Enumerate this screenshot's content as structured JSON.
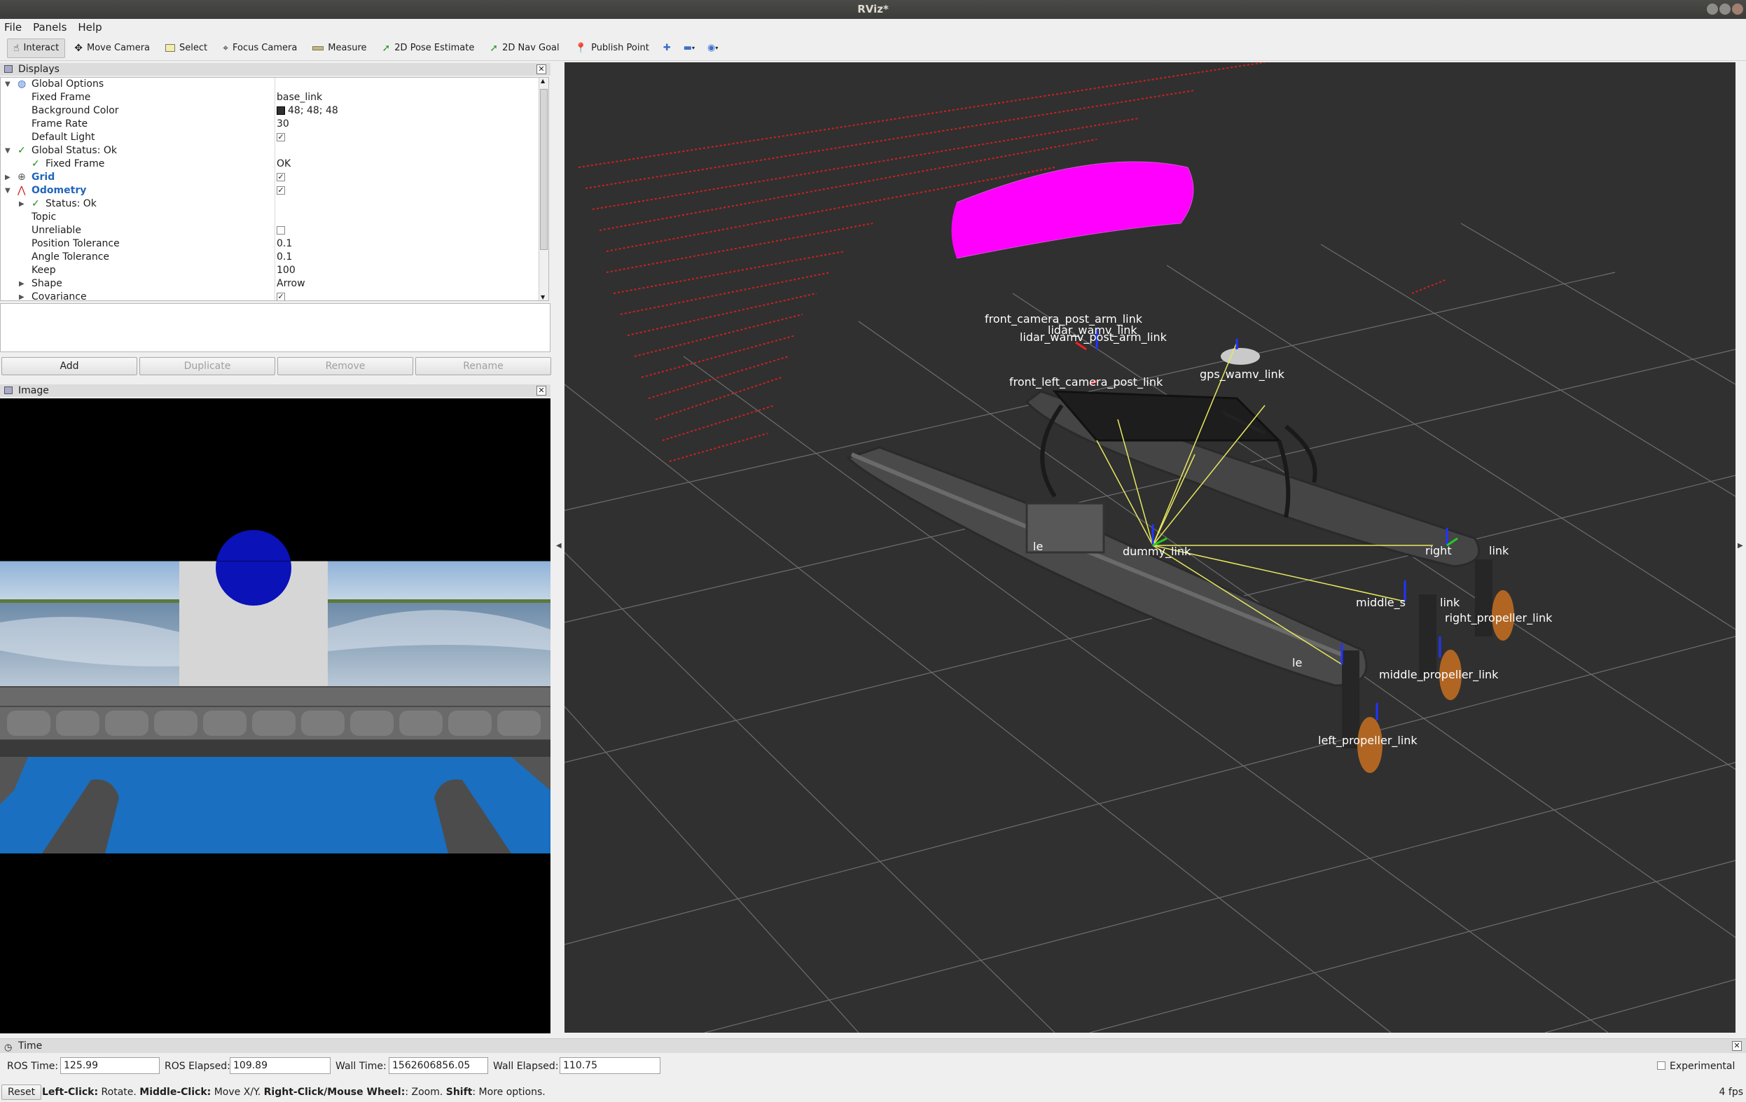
{
  "window": {
    "title": "RViz*"
  },
  "menu": [
    "File",
    "Panels",
    "Help"
  ],
  "toolbar": {
    "interact": "Interact",
    "move_camera": "Move Camera",
    "select": "Select",
    "focus_camera": "Focus Camera",
    "measure": "Measure",
    "pose_estimate": "2D Pose Estimate",
    "nav_goal": "2D Nav Goal",
    "publish_point": "Publish Point"
  },
  "displays": {
    "title": "Displays",
    "rows": {
      "global_options": "Global Options",
      "fixed_frame": {
        "label": "Fixed Frame",
        "value": "base_link"
      },
      "background_color": {
        "label": "Background Color",
        "value": "48; 48; 48"
      },
      "frame_rate": {
        "label": "Frame Rate",
        "value": "30"
      },
      "default_light": {
        "label": "Default Light"
      },
      "global_status": "Global Status: Ok",
      "fixed_frame_status": {
        "label": "Fixed Frame",
        "value": "OK"
      },
      "grid": "Grid",
      "odometry": "Odometry",
      "status": "Status: Ok",
      "topic": {
        "label": "Topic"
      },
      "unreliable": {
        "label": "Unreliable"
      },
      "position_tolerance": {
        "label": "Position Tolerance",
        "value": "0.1"
      },
      "angle_tolerance": {
        "label": "Angle Tolerance",
        "value": "0.1"
      },
      "keep": {
        "label": "Keep",
        "value": "100"
      },
      "shape": {
        "label": "Shape",
        "value": "Arrow"
      },
      "covariance": {
        "label": "Covariance"
      }
    },
    "buttons": {
      "add": "Add",
      "duplicate": "Duplicate",
      "remove": "Remove",
      "rename": "Rename"
    }
  },
  "image_panel": {
    "title": "Image"
  },
  "tf_labels": {
    "front_camera_post_arm": "front_camera_post_arm_link",
    "lidar_wamv_post_arm": "lidar_wamv_post_arm_link",
    "lidar_wamv": "lidar_wamv_link",
    "front_left_camera_post": "front_left_camera_post_link",
    "gps_wamv": "gps_wamv_link",
    "middle_partial_1": "middle_s",
    "middle_partial_2": "link",
    "middle_propeller": "middle_propeller_link",
    "right_propeller": "right_propeller_link",
    "right_partial_1": "right",
    "right_partial_2": "link",
    "left_propeller": "left_propeller_link",
    "left_partial": "le",
    "base_partial": "le",
    "dummy": "dummy_link"
  },
  "time_panel": {
    "title": "Time",
    "ros_time": {
      "label": "ROS Time:",
      "value": "125.99"
    },
    "ros_elapsed": {
      "label": "ROS Elapsed:",
      "value": "109.89"
    },
    "wall_time": {
      "label": "Wall Time:",
      "value": "1562606856.05"
    },
    "wall_elapsed": {
      "label": "Wall Elapsed:",
      "value": "110.75"
    },
    "experimental": "Experimental"
  },
  "status": {
    "reset": "Reset",
    "hint_left": "Left-Click:",
    "hint_left_txt": " Rotate. ",
    "hint_middle": "Middle-Click:",
    "hint_middle_txt": " Move X/Y. ",
    "hint_right": "Right-Click/Mouse Wheel:",
    "hint_right_txt": ": Zoom. ",
    "hint_shift": "Shift",
    "hint_shift_txt": ": More options.",
    "fps": "4 fps"
  },
  "colors": {
    "view_bg": "#303030",
    "lidar_points": "#d02020",
    "pointcloud": "#ff00ff",
    "odom_line": "#e8e860"
  }
}
